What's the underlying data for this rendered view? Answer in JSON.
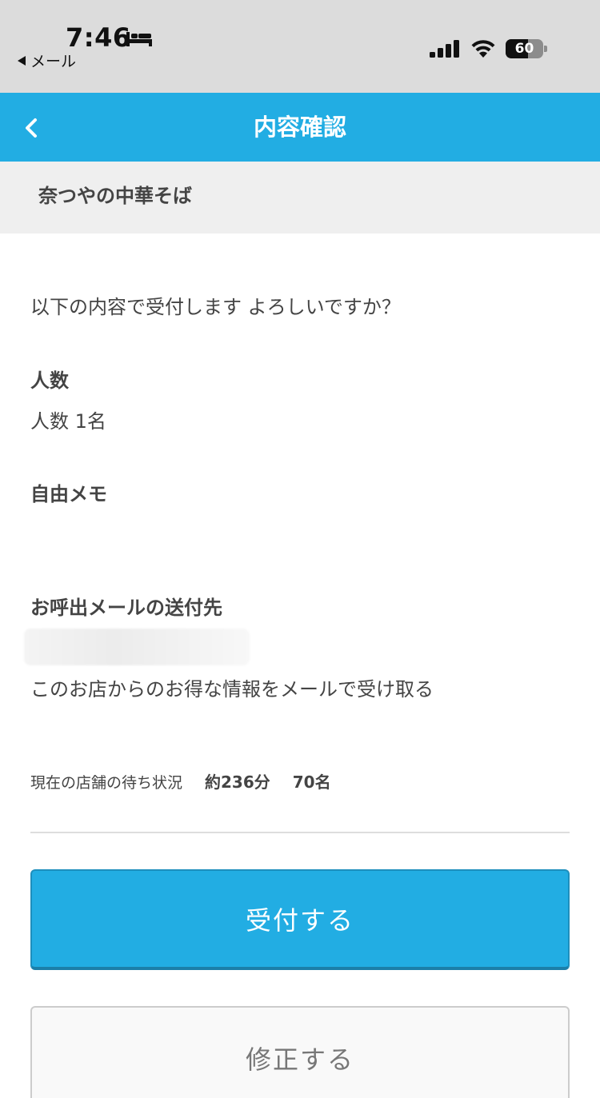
{
  "status_bar": {
    "time": "7:46",
    "back_app": "メール",
    "battery": "60",
    "battery_level": 0.6
  },
  "header": {
    "title": "内容確認"
  },
  "store": {
    "name": "奈つやの中華そば"
  },
  "content": {
    "prompt": "以下の内容で受付します よろしいですか？",
    "people_label": "人数",
    "people_value": "人数 1名",
    "memo_label": "自由メモ",
    "memo_value": "",
    "email_label": "お呼出メールの送付先",
    "email_value": "",
    "promo_text": "このお店からのお得な情報をメールで受け取る"
  },
  "wait_status": {
    "label": "現在の店舗の待ち状況",
    "time": "約236分",
    "count": "70名"
  },
  "buttons": {
    "submit": "受付する",
    "edit": "修正する"
  }
}
